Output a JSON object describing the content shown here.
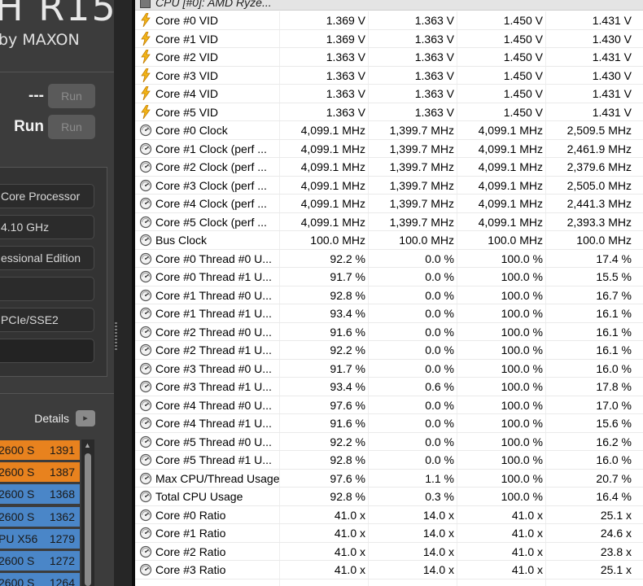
{
  "cinebench": {
    "logo_title": "H R15",
    "logo_sub": "by MAXON",
    "run_rows": [
      {
        "label": "---",
        "button": "Run"
      },
      {
        "label": "Run",
        "button": "Run"
      }
    ],
    "system_fields": [
      "Core Processor",
      "4.10 GHz",
      "essional Edition",
      "",
      "PCIe/SSE2",
      ""
    ],
    "details_label": "Details",
    "details_button": "▸",
    "ranking": [
      {
        "name": "2600 S",
        "score": "1391",
        "color": "#e8821e"
      },
      {
        "name": "2600 S",
        "score": "1387",
        "color": "#e8821e"
      },
      {
        "name": "2600 S",
        "score": "1368",
        "color": "#4a86c8"
      },
      {
        "name": "2600 S",
        "score": "1362",
        "color": "#4a86c8"
      },
      {
        "name": "PU X56",
        "score": "1279",
        "color": "#4a86c8"
      },
      {
        "name": "2600 S",
        "score": "1272",
        "color": "#4a86c8"
      },
      {
        "name": "2600 S",
        "score": "1264",
        "color": "#4a86c8"
      }
    ]
  },
  "hwinfo": {
    "group_title": "CPU [#0]: AMD Ryze...",
    "rows": [
      {
        "icon": "bolt",
        "label": "Core #0 VID",
        "current": "1.369 V",
        "min": "1.363 V",
        "max": "1.450 V",
        "avg": "1.431 V"
      },
      {
        "icon": "bolt",
        "label": "Core #1 VID",
        "current": "1.369 V",
        "min": "1.363 V",
        "max": "1.450 V",
        "avg": "1.430 V"
      },
      {
        "icon": "bolt",
        "label": "Core #2 VID",
        "current": "1.363 V",
        "min": "1.363 V",
        "max": "1.450 V",
        "avg": "1.431 V"
      },
      {
        "icon": "bolt",
        "label": "Core #3 VID",
        "current": "1.363 V",
        "min": "1.363 V",
        "max": "1.450 V",
        "avg": "1.430 V"
      },
      {
        "icon": "bolt",
        "label": "Core #4 VID",
        "current": "1.363 V",
        "min": "1.363 V",
        "max": "1.450 V",
        "avg": "1.431 V"
      },
      {
        "icon": "bolt",
        "label": "Core #5 VID",
        "current": "1.363 V",
        "min": "1.363 V",
        "max": "1.450 V",
        "avg": "1.431 V"
      },
      {
        "icon": "gauge",
        "label": "Core #0 Clock",
        "current": "4,099.1 MHz",
        "min": "1,399.7 MHz",
        "max": "4,099.1 MHz",
        "avg": "2,509.5 MHz"
      },
      {
        "icon": "gauge",
        "label": "Core #1 Clock (perf ...",
        "current": "4,099.1 MHz",
        "min": "1,399.7 MHz",
        "max": "4,099.1 MHz",
        "avg": "2,461.9 MHz"
      },
      {
        "icon": "gauge",
        "label": "Core #2 Clock (perf ...",
        "current": "4,099.1 MHz",
        "min": "1,399.7 MHz",
        "max": "4,099.1 MHz",
        "avg": "2,379.6 MHz"
      },
      {
        "icon": "gauge",
        "label": "Core #3 Clock (perf ...",
        "current": "4,099.1 MHz",
        "min": "1,399.7 MHz",
        "max": "4,099.1 MHz",
        "avg": "2,505.0 MHz"
      },
      {
        "icon": "gauge",
        "label": "Core #4 Clock (perf ...",
        "current": "4,099.1 MHz",
        "min": "1,399.7 MHz",
        "max": "4,099.1 MHz",
        "avg": "2,441.3 MHz"
      },
      {
        "icon": "gauge",
        "label": "Core #5 Clock (perf ...",
        "current": "4,099.1 MHz",
        "min": "1,399.7 MHz",
        "max": "4,099.1 MHz",
        "avg": "2,393.3 MHz"
      },
      {
        "icon": "gauge",
        "label": "Bus Clock",
        "current": "100.0 MHz",
        "min": "100.0 MHz",
        "max": "100.0 MHz",
        "avg": "100.0 MHz"
      },
      {
        "icon": "gauge",
        "label": "Core #0 Thread #0 U...",
        "current": "92.2 %",
        "min": "0.0 %",
        "max": "100.0 %",
        "avg": "17.4 %"
      },
      {
        "icon": "gauge",
        "label": "Core #0 Thread #1 U...",
        "current": "91.7 %",
        "min": "0.0 %",
        "max": "100.0 %",
        "avg": "15.5 %"
      },
      {
        "icon": "gauge",
        "label": "Core #1 Thread #0 U...",
        "current": "92.8 %",
        "min": "0.0 %",
        "max": "100.0 %",
        "avg": "16.7 %"
      },
      {
        "icon": "gauge",
        "label": "Core #1 Thread #1 U...",
        "current": "93.4 %",
        "min": "0.0 %",
        "max": "100.0 %",
        "avg": "16.1 %"
      },
      {
        "icon": "gauge",
        "label": "Core #2 Thread #0 U...",
        "current": "91.6 %",
        "min": "0.0 %",
        "max": "100.0 %",
        "avg": "16.1 %"
      },
      {
        "icon": "gauge",
        "label": "Core #2 Thread #1 U...",
        "current": "92.2 %",
        "min": "0.0 %",
        "max": "100.0 %",
        "avg": "16.1 %"
      },
      {
        "icon": "gauge",
        "label": "Core #3 Thread #0 U...",
        "current": "91.7 %",
        "min": "0.0 %",
        "max": "100.0 %",
        "avg": "16.0 %"
      },
      {
        "icon": "gauge",
        "label": "Core #3 Thread #1 U...",
        "current": "93.4 %",
        "min": "0.6 %",
        "max": "100.0 %",
        "avg": "17.8 %"
      },
      {
        "icon": "gauge",
        "label": "Core #4 Thread #0 U...",
        "current": "97.6 %",
        "min": "0.0 %",
        "max": "100.0 %",
        "avg": "17.0 %"
      },
      {
        "icon": "gauge",
        "label": "Core #4 Thread #1 U...",
        "current": "91.6 %",
        "min": "0.0 %",
        "max": "100.0 %",
        "avg": "15.6 %"
      },
      {
        "icon": "gauge",
        "label": "Core #5 Thread #0 U...",
        "current": "92.2 %",
        "min": "0.0 %",
        "max": "100.0 %",
        "avg": "16.2 %"
      },
      {
        "icon": "gauge",
        "label": "Core #5 Thread #1 U...",
        "current": "92.8 %",
        "min": "0.0 %",
        "max": "100.0 %",
        "avg": "16.0 %"
      },
      {
        "icon": "gauge",
        "label": "Max CPU/Thread Usage",
        "current": "97.6 %",
        "min": "1.1 %",
        "max": "100.0 %",
        "avg": "20.7 %"
      },
      {
        "icon": "gauge",
        "label": "Total CPU Usage",
        "current": "92.8 %",
        "min": "0.3 %",
        "max": "100.0 %",
        "avg": "16.4 %"
      },
      {
        "icon": "gauge",
        "label": "Core #0 Ratio",
        "current": "41.0 x",
        "min": "14.0 x",
        "max": "41.0 x",
        "avg": "25.1 x"
      },
      {
        "icon": "gauge",
        "label": "Core #1 Ratio",
        "current": "41.0 x",
        "min": "14.0 x",
        "max": "41.0 x",
        "avg": "24.6 x"
      },
      {
        "icon": "gauge",
        "label": "Core #2 Ratio",
        "current": "41.0 x",
        "min": "14.0 x",
        "max": "41.0 x",
        "avg": "23.8 x"
      },
      {
        "icon": "gauge",
        "label": "Core #3 Ratio",
        "current": "41.0 x",
        "min": "14.0 x",
        "max": "41.0 x",
        "avg": "25.1 x"
      }
    ]
  }
}
